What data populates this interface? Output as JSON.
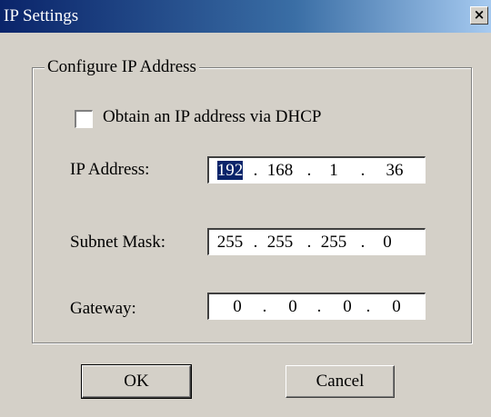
{
  "window": {
    "title": "IP Settings",
    "close_glyph": "×",
    "close_icon": "close-icon"
  },
  "group": {
    "label": "Configure IP Address"
  },
  "dhcp": {
    "label": "Obtain an IP address via DHCP",
    "checked": false
  },
  "fields": {
    "ip": {
      "label": "IP Address:",
      "octets": [
        "192",
        "168",
        "1",
        "36"
      ],
      "selected_octet": 0
    },
    "subnet": {
      "label": "Subnet Mask:",
      "octets": [
        "255",
        "255",
        "255",
        "0"
      ]
    },
    "gateway": {
      "label": "Gateway:",
      "octets": [
        "0",
        "0",
        "0",
        "0"
      ]
    }
  },
  "buttons": {
    "ok": "OK",
    "cancel": "Cancel"
  }
}
